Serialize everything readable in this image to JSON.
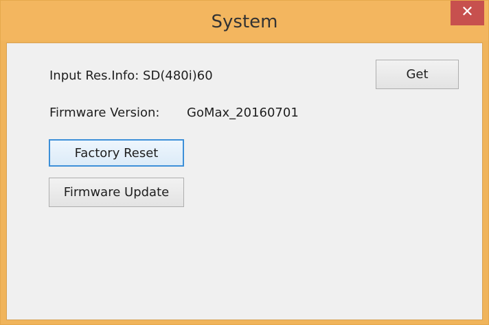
{
  "window": {
    "title": "System",
    "close_glyph": "✕"
  },
  "info": {
    "input_res_label": "Input Res.Info: SD(480i)60",
    "firmware_version_label": "Firmware Version:",
    "firmware_version_value": "GoMax_20160701"
  },
  "buttons": {
    "get_label": "Get",
    "factory_reset_label": "Factory Reset",
    "firmware_update_label": "Firmware Update"
  },
  "icons": {
    "close": "close-icon"
  },
  "colors": {
    "titlebar": "#f3b65f",
    "close_button": "#c7504e",
    "client_background": "#f0f0f0",
    "focus_border": "#3c8fd8"
  }
}
